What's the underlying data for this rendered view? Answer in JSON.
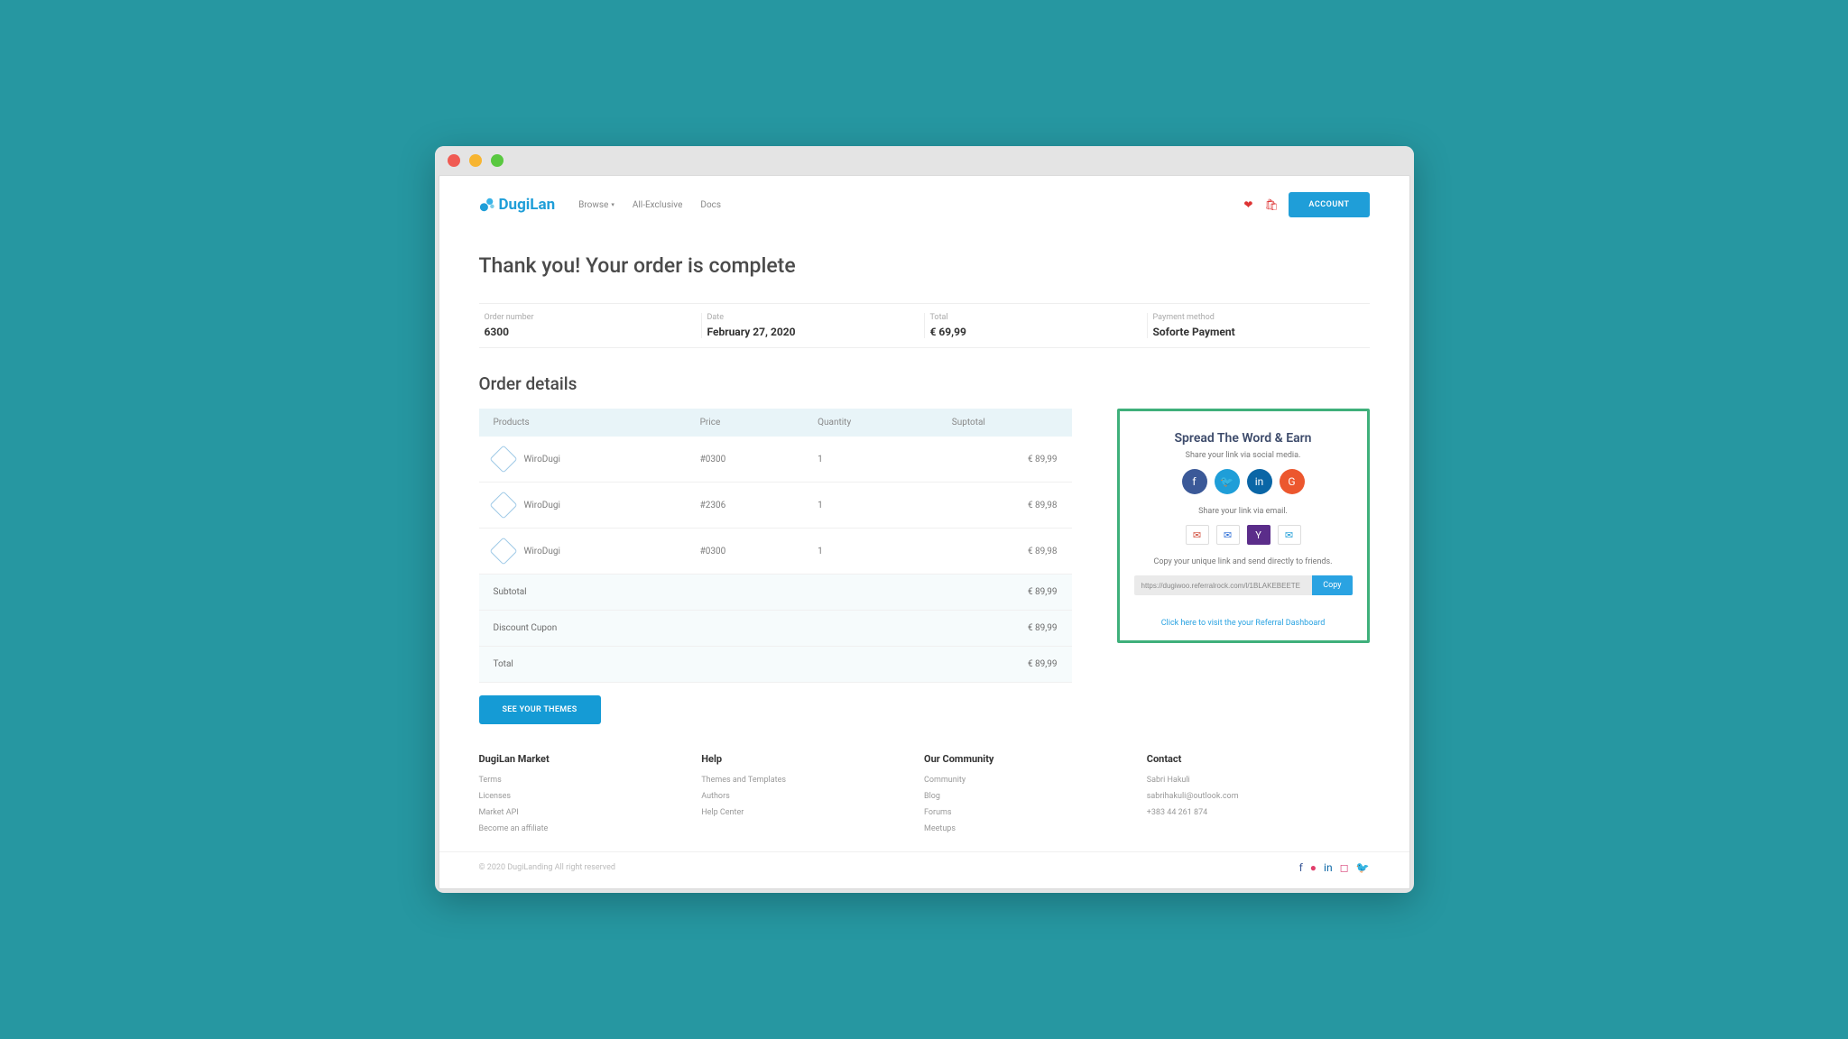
{
  "brand": "DugiLan",
  "nav": {
    "browse": "Browse",
    "allexclusive": "All-Exclusive",
    "docs": "Docs"
  },
  "header": {
    "account": "ACCOUNT"
  },
  "page_title": "Thank you! Your order is complete",
  "summary": {
    "order_number_label": "Order number",
    "order_number": "6300",
    "date_label": "Date",
    "date": "February 27, 2020",
    "total_label": "Total",
    "total": "€ 69,99",
    "payment_label": "Payment method",
    "payment": "Soforte Payment"
  },
  "section_title": "Order details",
  "table": {
    "headers": {
      "products": "Products",
      "price": "Price",
      "quantity": "Quantity",
      "subtotal": "Suptotal"
    },
    "rows": [
      {
        "name": "WiroDugi",
        "price": "#0300",
        "qty": "1",
        "subtotal": "€ 89,99"
      },
      {
        "name": "WiroDugi",
        "price": "#2306",
        "qty": "1",
        "subtotal": "€ 89,98"
      },
      {
        "name": "WiroDugi",
        "price": "#0300",
        "qty": "1",
        "subtotal": "€ 89,98"
      }
    ],
    "subtotals": [
      {
        "label": "Subtotal",
        "value": "€ 89,99"
      },
      {
        "label": "Discount Cupon",
        "value": "€ 89,99"
      },
      {
        "label": "Total",
        "value": "€ 89,99"
      }
    ]
  },
  "themes_button": "SEE YOUR THEMES",
  "referral": {
    "title": "Spread The Word & Earn",
    "social_sub": "Share your link via social media.",
    "email_sub": "Share your link via email.",
    "copy_sub": "Copy your unique link and send directly to friends.",
    "link_value": "https://dugiwoo.referralrock.com/l/1BLAKEBEETE",
    "copy": "Copy",
    "dashboard": "Click here to visit the your Referral Dashboard"
  },
  "footer": {
    "market": {
      "title": "DugiLan Market",
      "items": [
        "Terms",
        "Licenses",
        "Market API",
        "Become an affiliate"
      ]
    },
    "help": {
      "title": "Help",
      "items": [
        "Themes and Templates",
        "Authors",
        "Help Center"
      ]
    },
    "community": {
      "title": "Our Community",
      "items": [
        "Community",
        "Blog",
        "Forums",
        "Meetups"
      ]
    },
    "contact": {
      "title": "Contact",
      "items": [
        "Sabri Hakuli",
        "sabrihakuli@outlook.com",
        "+383 44 261 874"
      ]
    }
  },
  "copyright": "© 2020 DugiLanding All right reserved"
}
